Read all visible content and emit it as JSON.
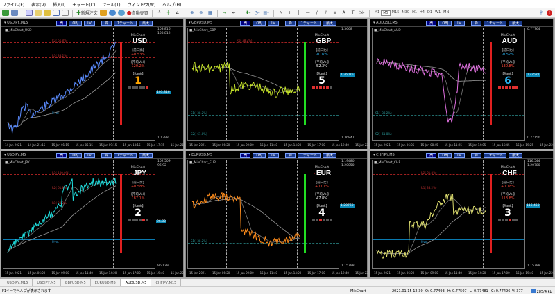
{
  "menu": [
    "ファイル(F)",
    "表示(V)",
    "挿入(I)",
    "チャート(C)",
    "ツール(T)",
    "ウィンドウ(W)",
    "ヘルプ(H)"
  ],
  "toolbar": {
    "new_order": "新規注文",
    "auto_trade": "自動売買",
    "timeframes": [
      "M1",
      "M5",
      "M15",
      "M30",
      "H1",
      "H4",
      "D1",
      "W1",
      "MN"
    ],
    "active_tf": "M5"
  },
  "chart_buttons": [
    "売",
    "OBJ",
    "LV",
    "枠",
    "1チャート",
    "最大"
  ],
  "info_labels": {
    "mixchart": "MixChart",
    "prev_day": "【前日比】",
    "avg_vol": "【平均Vol】",
    "rank": "【Rank】"
  },
  "charts": [
    {
      "title": "USDJPY,M15",
      "indicator": "■_MixChart_USD",
      "currency": "USD",
      "change": "+0.53%",
      "change_color": "#ff4a3a",
      "avgvol": "120.2%",
      "avgvol_color": "#ff4a3a",
      "rank": "1",
      "rank_color": "#ffa500",
      "bar_color": "#e02020",
      "line_color": "#5b8cff",
      "prices": [
        "103.816",
        "103.812"
      ],
      "current": "103.816",
      "bottom": "1.1398",
      "levels": [
        "R2( 61.8%)",
        "R1( 38.2%)"
      ],
      "pivot": "Pivot",
      "times": [
        "14 Jan 2021",
        "14 Jan 21:15",
        "15 Jan 01:15",
        "15 Jan 05:15",
        "15 Jan 09:15",
        "15 Jan 13:15",
        "15 Jan 17:15",
        "15 Jan 21:15"
      ]
    },
    {
      "title": "GBPUSD,M5",
      "indicator": "■_MixChart_GBP",
      "currency": "GBP",
      "change": "-0.07%",
      "change_color": "#29b6f6",
      "avgvol": "52.3%",
      "avgvol_color": "#ffffff",
      "rank": "5",
      "rank_color": "#ffffff",
      "bar_color": "#22dd22",
      "line_color": "#c8e62a",
      "prices": [
        "1.3668"
      ],
      "current": "1.36075",
      "bottom": "1.36847",
      "levels": [
        "R1( 38.2%)"
      ],
      "levels_g": [
        "S1( -38.2%)",
        "S2( -61.8%)"
      ],
      "times": [
        "15 Jan 2021",
        "15 Jan 06:20",
        "15 Jan 09:00",
        "15 Jan 11:40",
        "15 Jan 14:20",
        "15 Jan 17:00",
        "15 Jan 19:40",
        "15 Jan 22:20"
      ]
    },
    {
      "title": "AUDUSD,M5",
      "indicator": "■_MixChart_AUD",
      "currency": "AUD",
      "change": "-0.52%",
      "change_color": "#29b6f6",
      "avgvol": "130.8%",
      "avgvol_color": "#ff4a3a",
      "rank": "6",
      "rank_color": "#29b6f6",
      "bar_color": "#e02020",
      "line_color": "#e070e0",
      "prices": [
        "0.77764"
      ],
      "current": "0.77521",
      "bottom": "0.77150",
      "levels_g": [
        "S1( -38.2%)",
        "S2( -61.8%)"
      ],
      "times": [
        "15 Jan 2021",
        "15 Jan 06:05",
        "15 Jan 08:45",
        "15 Jan 11:25",
        "15 Jan 14:05",
        "15 Jan 16:45",
        "15 Jan 19:25",
        "15 Jan 22:05"
      ]
    },
    {
      "title": "USDJPY,M5",
      "indicator": "■_MixChart_JPY",
      "currency": "JPY",
      "change": "+0.58%",
      "change_color": "#ff4a3a",
      "avgvol": "187.1%",
      "avgvol_color": "#ff4a3a",
      "rank": "2",
      "rank_color": "#ffffff",
      "bar_color": "#e02020",
      "line_color": "#20e0e0",
      "prices": [
        "102.509",
        "96.92"
      ],
      "current": "96.80",
      "bottom": "96.129",
      "levels": [
        "R3( 100.0%)",
        "R2( 61.8%)",
        "R1( 38.2%)"
      ],
      "pivot": "Pivot",
      "times": [
        "15 Jan 2021",
        "15 Jan 06:20",
        "15 Jan 09:00",
        "15 Jan 11:40",
        "15 Jan 14:20",
        "15 Jan 17:00",
        "15 Jan 19:40",
        "15 Jan 22:20"
      ]
    },
    {
      "title": "EURUSD,M5",
      "indicator": "■_MixChart_EUR",
      "currency": "EUR",
      "change": "+0.01%",
      "change_color": "#ff4a3a",
      "avgvol": "47.8%",
      "avgvol_color": "#ffffff",
      "rank": "4",
      "rank_color": "#ffffff",
      "bar_color": "#22dd22",
      "line_color": "#ff8c1a",
      "prices": [
        "1.19480",
        "1.20050"
      ],
      "current": "1.20760",
      "bottom": "1.15798",
      "levels_g": [
        "S1( -38.2%)"
      ],
      "times": [
        "15 Jan 2021",
        "15 Jan 06:20",
        "15 Jan 09:00",
        "15 Jan 11:40",
        "15 Jan 14:20",
        "15 Jan 17:00",
        "15 Jan 19:40",
        "15 Jan 22:20"
      ]
    },
    {
      "title": "CHFJPY,M5",
      "indicator": "■_MixChart_CHF",
      "currency": "CHF",
      "change": "+0.18%",
      "change_color": "#ff4a3a",
      "avgvol": "113.8%",
      "avgvol_color": "#ff4a3a",
      "rank": "3",
      "rank_color": "#ffffff",
      "bar_color": "#e02020",
      "line_color": "#e0e070",
      "prices": [
        "116.544",
        "1.20780"
      ],
      "current": "116.450",
      "bottom": "1.15788",
      "levels": [
        "R2( 61.8%)",
        "R1( 38.2%)"
      ],
      "pivot": "Pivot",
      "times": [
        "15 Jan 2021",
        "15 Jan 06:20",
        "15 Jan 09:00",
        "15 Jan 11:40",
        "15 Jan 14:20",
        "15 Jan 17:00",
        "15 Jan 19:40",
        "15 Jan 22:20"
      ]
    }
  ],
  "tabs": [
    "USDJPY,M15",
    "USDJPY,M5",
    "GBPUSD,M5",
    "EURUSD,M5",
    "AUDUSD,M5",
    "CHFJPY,M15"
  ],
  "active_tab": "AUDUSD,M5",
  "status": {
    "help": "F1キーでヘルプが表示されます",
    "profile": "MixChart",
    "datetime": "2021.01.15 12:30",
    "open": "O: 0.77493",
    "high": "H: 0.77507",
    "low": "L: 0.77481",
    "close": "C: 0.77496",
    "volume": "V: 377",
    "traffic": "285/4 kb"
  }
}
